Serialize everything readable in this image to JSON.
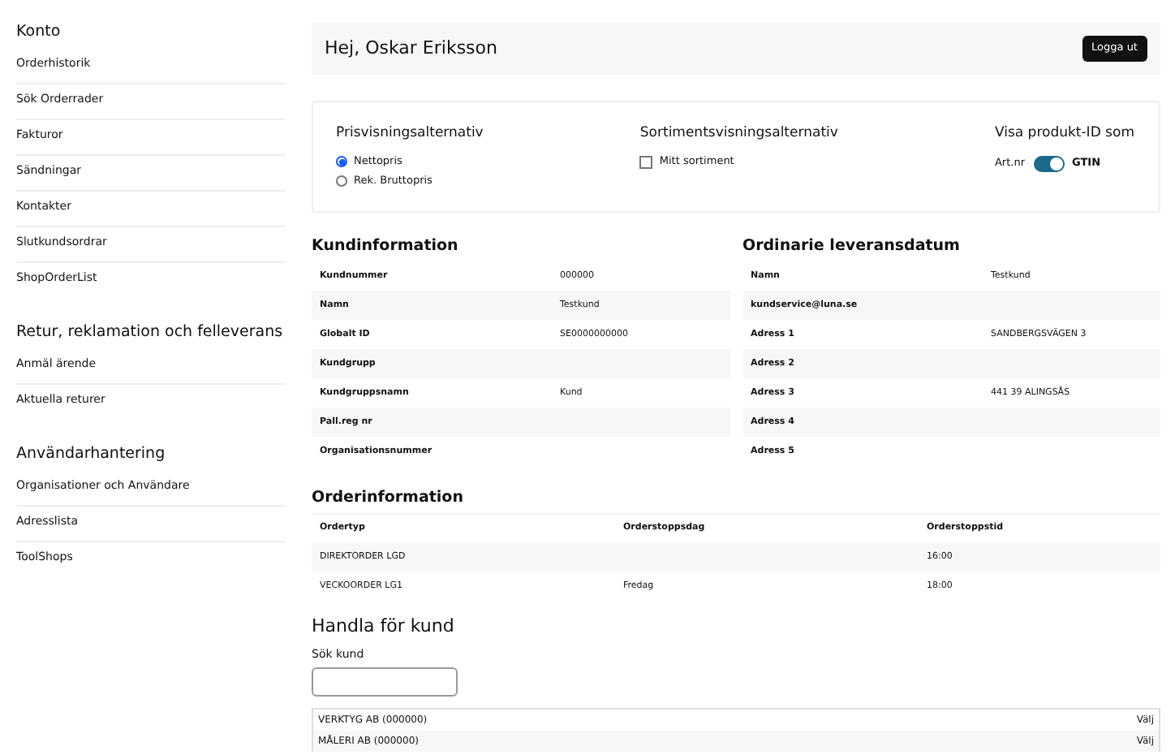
{
  "sidebar": {
    "sections": [
      {
        "title": "Konto",
        "items": [
          "Orderhistorik",
          "Sök Orderrader",
          "Fakturor",
          "Sändningar",
          "Kontakter",
          "Slutkundsordrar",
          "ShopOrderList"
        ]
      },
      {
        "title": "Retur, reklamation och felleverans",
        "items": [
          "Anmäl ärende",
          "Aktuella returer"
        ]
      },
      {
        "title": "Användarhantering",
        "items": [
          "Organisationer och Användare",
          "Adresslista",
          "ToolShops"
        ]
      }
    ]
  },
  "header": {
    "greeting": "Hej, Oskar Eriksson",
    "logout_button": "Logga ut"
  },
  "settings": {
    "price_display": {
      "title": "Prisvisningsalternativ",
      "options": [
        {
          "label": "Nettopris",
          "selected": true
        },
        {
          "label": "Rek. Bruttopris",
          "selected": false
        }
      ]
    },
    "assortment_display": {
      "title": "Sortimentsvisningsalternativ",
      "checkbox": {
        "label": "Mitt sortiment",
        "checked": false
      }
    },
    "product_id": {
      "title": "Visa produkt-ID som",
      "off_label": "Art.nr",
      "on_label": "GTIN",
      "on": true
    }
  },
  "customer_info": {
    "title": "Kundinformation",
    "rows": [
      {
        "label": "Kundnummer",
        "value": "000000"
      },
      {
        "label": "Namn",
        "value": "Testkund"
      },
      {
        "label": "Globalt ID",
        "value": "SE0000000000"
      },
      {
        "label": "Kundgrupp"
      },
      {
        "label": "Kundgruppsnamn",
        "value": "Kund"
      },
      {
        "label": "Pall.reg nr"
      },
      {
        "label": "Organisationsnummer"
      }
    ]
  },
  "delivery": {
    "title": "Ordinarie leveransdatum",
    "rows": [
      {
        "label": "Namn",
        "value": "Testkund"
      },
      {
        "label": "kundservice@luna.se"
      },
      {
        "label": "Adress 1",
        "value": "SANDBERGSVÄGEN 3"
      },
      {
        "label": "Adress 2"
      },
      {
        "label": "Adress 3",
        "value": "441 39 ALINGSÅS"
      },
      {
        "label": "Adress 4"
      },
      {
        "label": "Adress 5"
      }
    ]
  },
  "order_info": {
    "title": "Orderinformation",
    "columns": [
      "Ordertyp",
      "Orderstoppsdag",
      "Orderstoppstid"
    ],
    "rows": [
      [
        "DIREKTORDER LGD",
        "",
        "16:00"
      ],
      [
        "VECKOORDER LG1",
        "Fredag",
        "18:00"
      ]
    ]
  },
  "shop_for_customer": {
    "title": "Handla för kund",
    "search_label": "Sök kund",
    "customers": [
      {
        "name": "VERKTYG AB (000000)",
        "action": "Välj"
      },
      {
        "name": "MÅLERI AB (000000)",
        "action": "Välj"
      }
    ]
  }
}
